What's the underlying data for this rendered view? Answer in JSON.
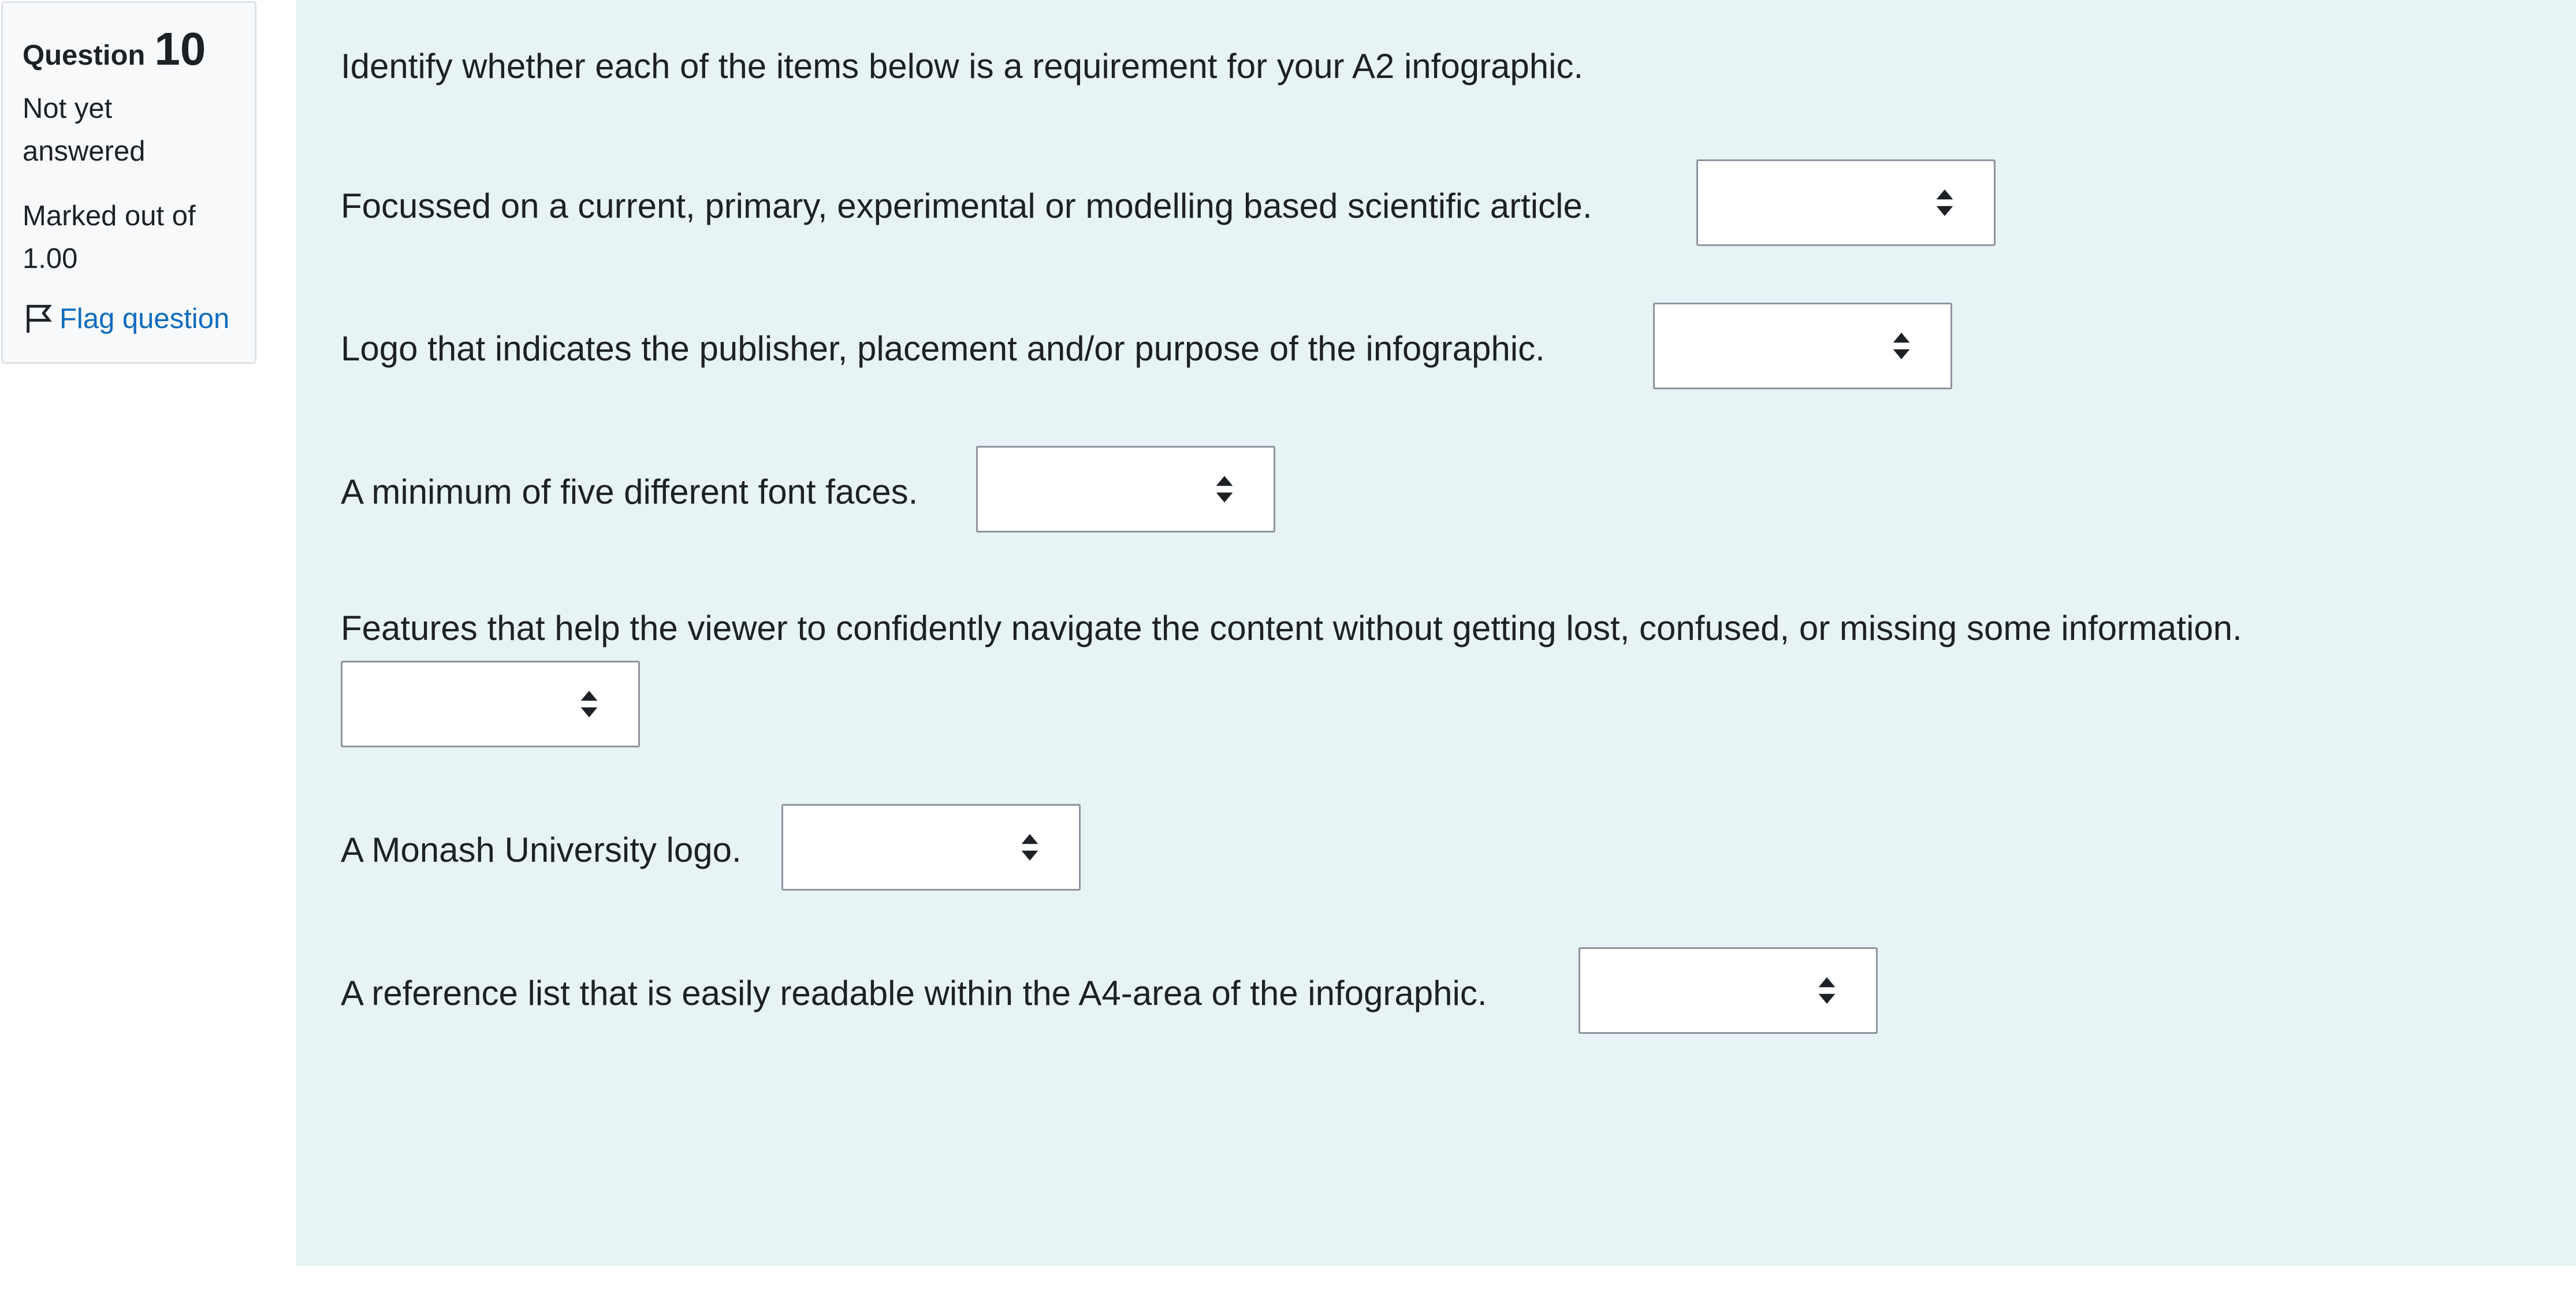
{
  "question": {
    "label": "Question",
    "number": "10",
    "state": "Not yet answered",
    "grade": "Marked out of 1.00",
    "flag_label": "Flag question"
  },
  "prompt": "Identify whether each of the items below is a requirement for your A2 infographic.",
  "items": [
    {
      "text": "Focussed on a current, primary, experimental or modelling based scientific article.",
      "selected": ""
    },
    {
      "text": "Logo that indicates the publisher, placement and/or purpose of the infographic.",
      "selected": ""
    },
    {
      "text": "A minimum of five different font faces.",
      "selected": ""
    },
    {
      "text": "Features that help the viewer to confidently navigate the content without getting lost, confused, or missing some information.",
      "selected": ""
    },
    {
      "text": "A Monash University logo.",
      "selected": ""
    },
    {
      "text": "A reference list that is easily readable within the A4-area of the infographic.",
      "selected": ""
    }
  ],
  "icons": {
    "flag": "flag-icon",
    "select_arrows": "sort-arrows-icon"
  },
  "colors": {
    "content_bg": "#e7f3f5",
    "info_bg": "#f8f9fa",
    "link": "#0f6cbf",
    "select_border": "#8f959e"
  }
}
